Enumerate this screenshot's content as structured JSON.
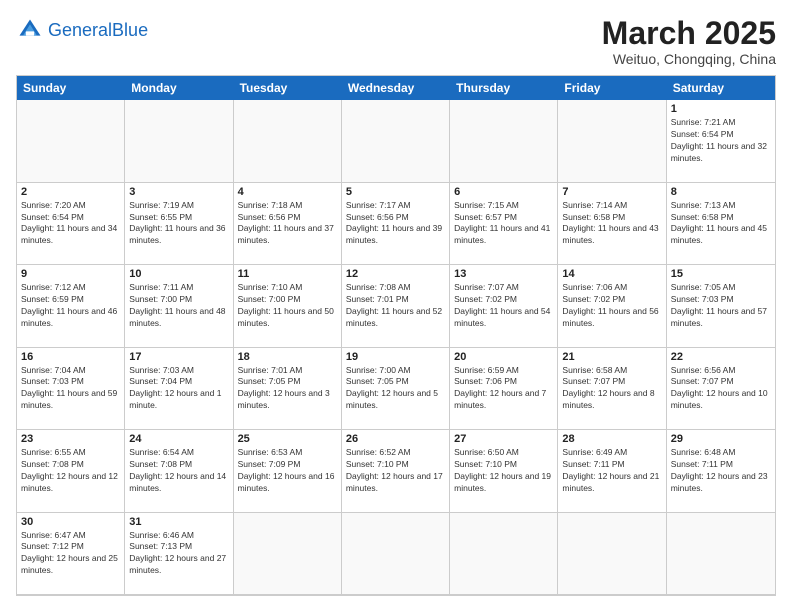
{
  "logo": {
    "text_general": "General",
    "text_blue": "Blue"
  },
  "title": "March 2025",
  "location": "Weituo, Chongqing, China",
  "dayHeaders": [
    "Sunday",
    "Monday",
    "Tuesday",
    "Wednesday",
    "Thursday",
    "Friday",
    "Saturday"
  ],
  "cells": [
    {
      "day": "",
      "empty": true
    },
    {
      "day": "",
      "empty": true
    },
    {
      "day": "",
      "empty": true
    },
    {
      "day": "",
      "empty": true
    },
    {
      "day": "",
      "empty": true
    },
    {
      "day": "",
      "empty": true
    },
    {
      "day": "1",
      "sunrise": "7:21 AM",
      "sunset": "6:54 PM",
      "daylight": "11 hours and 32 minutes."
    },
    {
      "day": "2",
      "sunrise": "7:20 AM",
      "sunset": "6:54 PM",
      "daylight": "11 hours and 34 minutes."
    },
    {
      "day": "3",
      "sunrise": "7:19 AM",
      "sunset": "6:55 PM",
      "daylight": "11 hours and 36 minutes."
    },
    {
      "day": "4",
      "sunrise": "7:18 AM",
      "sunset": "6:56 PM",
      "daylight": "11 hours and 37 minutes."
    },
    {
      "day": "5",
      "sunrise": "7:17 AM",
      "sunset": "6:56 PM",
      "daylight": "11 hours and 39 minutes."
    },
    {
      "day": "6",
      "sunrise": "7:15 AM",
      "sunset": "6:57 PM",
      "daylight": "11 hours and 41 minutes."
    },
    {
      "day": "7",
      "sunrise": "7:14 AM",
      "sunset": "6:58 PM",
      "daylight": "11 hours and 43 minutes."
    },
    {
      "day": "8",
      "sunrise": "7:13 AM",
      "sunset": "6:58 PM",
      "daylight": "11 hours and 45 minutes."
    },
    {
      "day": "9",
      "sunrise": "7:12 AM",
      "sunset": "6:59 PM",
      "daylight": "11 hours and 46 minutes."
    },
    {
      "day": "10",
      "sunrise": "7:11 AM",
      "sunset": "7:00 PM",
      "daylight": "11 hours and 48 minutes."
    },
    {
      "day": "11",
      "sunrise": "7:10 AM",
      "sunset": "7:00 PM",
      "daylight": "11 hours and 50 minutes."
    },
    {
      "day": "12",
      "sunrise": "7:08 AM",
      "sunset": "7:01 PM",
      "daylight": "11 hours and 52 minutes."
    },
    {
      "day": "13",
      "sunrise": "7:07 AM",
      "sunset": "7:02 PM",
      "daylight": "11 hours and 54 minutes."
    },
    {
      "day": "14",
      "sunrise": "7:06 AM",
      "sunset": "7:02 PM",
      "daylight": "11 hours and 56 minutes."
    },
    {
      "day": "15",
      "sunrise": "7:05 AM",
      "sunset": "7:03 PM",
      "daylight": "11 hours and 57 minutes."
    },
    {
      "day": "16",
      "sunrise": "7:04 AM",
      "sunset": "7:03 PM",
      "daylight": "11 hours and 59 minutes."
    },
    {
      "day": "17",
      "sunrise": "7:03 AM",
      "sunset": "7:04 PM",
      "daylight": "12 hours and 1 minute."
    },
    {
      "day": "18",
      "sunrise": "7:01 AM",
      "sunset": "7:05 PM",
      "daylight": "12 hours and 3 minutes."
    },
    {
      "day": "19",
      "sunrise": "7:00 AM",
      "sunset": "7:05 PM",
      "daylight": "12 hours and 5 minutes."
    },
    {
      "day": "20",
      "sunrise": "6:59 AM",
      "sunset": "7:06 PM",
      "daylight": "12 hours and 7 minutes."
    },
    {
      "day": "21",
      "sunrise": "6:58 AM",
      "sunset": "7:07 PM",
      "daylight": "12 hours and 8 minutes."
    },
    {
      "day": "22",
      "sunrise": "6:56 AM",
      "sunset": "7:07 PM",
      "daylight": "12 hours and 10 minutes."
    },
    {
      "day": "23",
      "sunrise": "6:55 AM",
      "sunset": "7:08 PM",
      "daylight": "12 hours and 12 minutes."
    },
    {
      "day": "24",
      "sunrise": "6:54 AM",
      "sunset": "7:08 PM",
      "daylight": "12 hours and 14 minutes."
    },
    {
      "day": "25",
      "sunrise": "6:53 AM",
      "sunset": "7:09 PM",
      "daylight": "12 hours and 16 minutes."
    },
    {
      "day": "26",
      "sunrise": "6:52 AM",
      "sunset": "7:10 PM",
      "daylight": "12 hours and 17 minutes."
    },
    {
      "day": "27",
      "sunrise": "6:50 AM",
      "sunset": "7:10 PM",
      "daylight": "12 hours and 19 minutes."
    },
    {
      "day": "28",
      "sunrise": "6:49 AM",
      "sunset": "7:11 PM",
      "daylight": "12 hours and 21 minutes."
    },
    {
      "day": "29",
      "sunrise": "6:48 AM",
      "sunset": "7:11 PM",
      "daylight": "12 hours and 23 minutes."
    },
    {
      "day": "30",
      "sunrise": "6:47 AM",
      "sunset": "7:12 PM",
      "daylight": "12 hours and 25 minutes."
    },
    {
      "day": "31",
      "sunrise": "6:46 AM",
      "sunset": "7:13 PM",
      "daylight": "12 hours and 27 minutes."
    },
    {
      "day": "",
      "empty": true
    },
    {
      "day": "",
      "empty": true
    },
    {
      "day": "",
      "empty": true
    },
    {
      "day": "",
      "empty": true
    },
    {
      "day": "",
      "empty": true
    }
  ]
}
